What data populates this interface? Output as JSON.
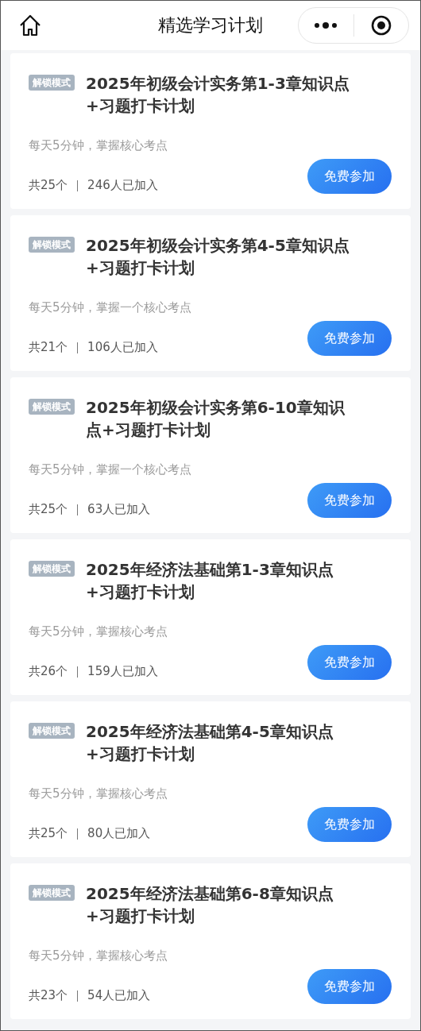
{
  "nav": {
    "title": "精选学习计划"
  },
  "plans": [
    {
      "tag": "解锁模式",
      "title": "2025年初级会计实务第1-3章知识点+习题打卡计划",
      "subtitle": "每天5分钟，掌握核心考点",
      "count": "共25个",
      "joined": "246人已加入",
      "button": "免费参加"
    },
    {
      "tag": "解锁模式",
      "title": "2025年初级会计实务第4-5章知识点+习题打卡计划",
      "subtitle": "每天5分钟，掌握一个核心考点",
      "count": "共21个",
      "joined": "106人已加入",
      "button": "免费参加"
    },
    {
      "tag": "解锁模式",
      "title": "2025年初级会计实务第6-10章知识点+习题打卡计划",
      "subtitle": "每天5分钟，掌握一个核心考点",
      "count": "共25个",
      "joined": "63人已加入",
      "button": "免费参加"
    },
    {
      "tag": "解锁模式",
      "title": "2025年经济法基础第1-3章知识点+习题打卡计划",
      "subtitle": "每天5分钟，掌握核心考点",
      "count": "共26个",
      "joined": "159人已加入",
      "button": "免费参加"
    },
    {
      "tag": "解锁模式",
      "title": "2025年经济法基础第4-5章知识点+习题打卡计划",
      "subtitle": "每天5分钟，掌握核心考点",
      "count": "共25个",
      "joined": "80人已加入",
      "button": "免费参加"
    },
    {
      "tag": "解锁模式",
      "title": "2025年经济法基础第6-8章知识点+习题打卡计划",
      "subtitle": "每天5分钟，掌握核心考点",
      "count": "共23个",
      "joined": "54人已加入",
      "button": "免费参加"
    }
  ]
}
